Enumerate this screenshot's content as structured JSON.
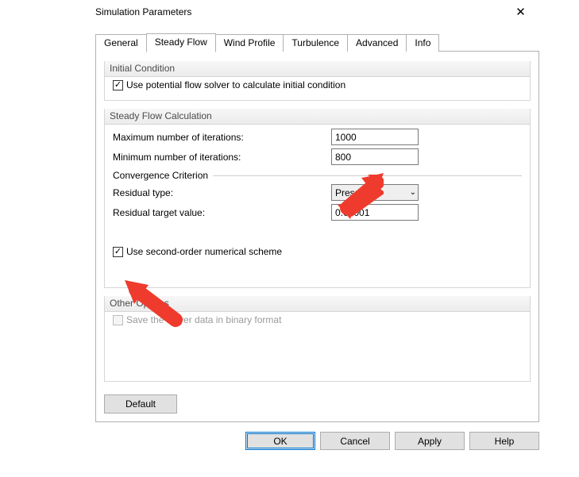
{
  "window": {
    "title": "Simulation Parameters",
    "close_glyph": "✕"
  },
  "tabs": {
    "general": "General",
    "steady": "Steady Flow",
    "wind": "Wind Profile",
    "turbulence": "Turbulence",
    "advanced": "Advanced",
    "info": "Info"
  },
  "initial": {
    "legend": "Initial Condition",
    "use_potential": "Use potential flow solver to calculate initial condition",
    "check": "✓"
  },
  "steady": {
    "legend": "Steady Flow Calculation",
    "max_iter_label": "Maximum number of iterations:",
    "max_iter_value": "1000",
    "min_iter_label": "Minimum number of iterations:",
    "min_iter_value": "800",
    "criterion": "Convergence Criterion",
    "residual_type_label": "Residual type:",
    "residual_type_value": "Pressure",
    "residual_target_label": "Residual target value:",
    "residual_target_value": "0.00001",
    "second_order": "Use second-order numerical scheme",
    "check": "✓"
  },
  "other": {
    "legend": "Other Options",
    "save_binary": "Save the solver data in binary format"
  },
  "buttons": {
    "default": "Default",
    "ok": "OK",
    "cancel": "Cancel",
    "apply": "Apply",
    "help": "Help"
  }
}
